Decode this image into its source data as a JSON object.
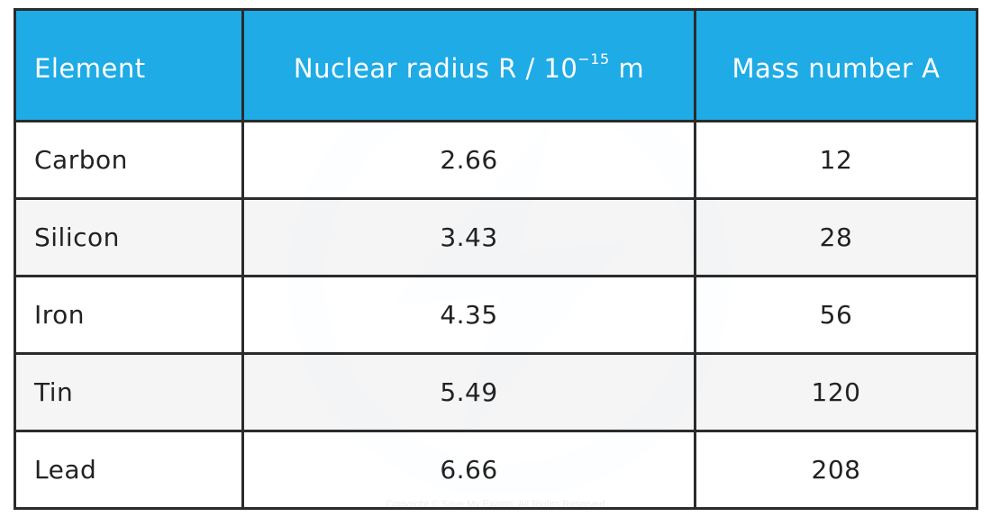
{
  "table": {
    "headers": {
      "element": "Element",
      "radius_prefix": "Nuclear radius R / 10",
      "radius_exp": "−15",
      "radius_unit": " m",
      "mass": "Mass number A"
    },
    "rows": [
      {
        "element": "Carbon",
        "radius": "2.66",
        "mass": "12"
      },
      {
        "element": "Silicon",
        "radius": "3.43",
        "mass": "28"
      },
      {
        "element": "Iron",
        "radius": "4.35",
        "mass": "56"
      },
      {
        "element": "Tin",
        "radius": "5.49",
        "mass": "120"
      },
      {
        "element": "Lead",
        "radius": "6.66",
        "mass": "208"
      }
    ]
  },
  "colors": {
    "header_bg": "#1eabe6",
    "border": "#2b2b2b",
    "alt_row": "#f3f3f3"
  },
  "footer": {
    "copyright": "Copyright © Save My Exams. All Rights Reserved"
  }
}
